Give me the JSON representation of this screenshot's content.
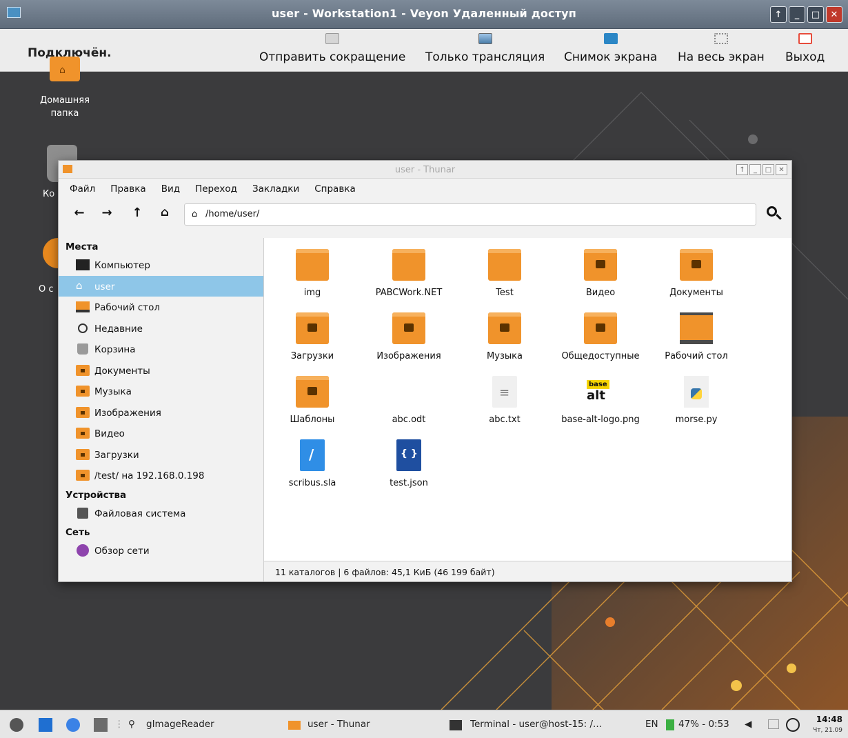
{
  "window": {
    "title": "user - Workstation1 - Veyon Удаленный доступ"
  },
  "toolbar": {
    "status": "Подключён.",
    "send_shortcut": "Отправить сокращение",
    "view_only": "Только трансляция",
    "screenshot": "Снимок экрана",
    "fullscreen": "На весь экран",
    "exit": "Выход"
  },
  "desktop": {
    "home_label": "Домашняя папка",
    "trash_label_partial": "Ко",
    "about_label_partial": "О с"
  },
  "thunar": {
    "title": "user - Thunar",
    "menu": [
      "Файл",
      "Правка",
      "Вид",
      "Переход",
      "Закладки",
      "Справка"
    ],
    "path": "/home/user/",
    "sidebar": {
      "places_header": "Места",
      "places": [
        "Компьютер",
        "user",
        "Рабочий стол",
        "Недавние",
        "Корзина",
        "Документы",
        "Музыка",
        "Изображения",
        "Видео",
        "Загрузки",
        "/test/ на 192.168.0.198"
      ],
      "devices_header": "Устройства",
      "devices": [
        "Файловая система"
      ],
      "network_header": "Сеть",
      "network": [
        "Обзор сети"
      ]
    },
    "files": [
      "img",
      "PABCWork.NET",
      "Test",
      "Видео",
      "Документы",
      "Загрузки",
      "Изображения",
      "Музыка",
      "Общедоступные",
      "Рабочий стол",
      "Шаблоны",
      "abc.odt",
      "abc.txt",
      "base-alt-logo.png",
      "morse.py",
      "scribus.sla",
      "test.json"
    ],
    "logo_text_top": "base",
    "logo_text_bottom": "alt",
    "status": "11 каталогов  |  6 файлов: 45,1 КиБ (46 199 байт)"
  },
  "taskbar": {
    "app1": "gImageReader",
    "app2": "user - Thunar",
    "app3": "Terminal - user@host-15: /...",
    "lang": "EN",
    "battery": "47% - 0:53",
    "time": "14:48",
    "date": "Чт, 21.09"
  },
  "colors": {
    "folder": "#f0932b",
    "selection": "#8ec6e8",
    "desktop": "#3b3b3d"
  }
}
